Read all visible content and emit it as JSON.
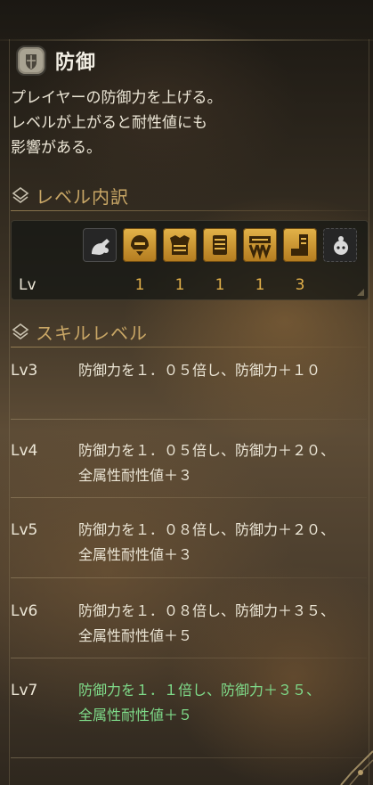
{
  "skill": {
    "name": "防御",
    "icon": "shield-icon",
    "description": [
      "プレイヤーの防御力を上げる。",
      "レベルが上がると耐性値にも",
      "影響がある。"
    ]
  },
  "breakdown": {
    "heading": "レベル内訳",
    "row_label": "Lv",
    "slots": [
      {
        "icon": "weapon-charm-icon",
        "value": ""
      },
      {
        "icon": "helmet-icon",
        "value": "1"
      },
      {
        "icon": "chest-armor-icon",
        "value": "1"
      },
      {
        "icon": "gauntlet-icon",
        "value": "1"
      },
      {
        "icon": "waist-armor-icon",
        "value": "1"
      },
      {
        "icon": "leg-armor-icon",
        "value": "3"
      },
      {
        "icon": "decoration-icon",
        "value": ""
      }
    ]
  },
  "skill_levels": {
    "heading": "スキルレベル",
    "levels": [
      {
        "name": "Lv3",
        "lines": [
          "防御力を１．０５倍し、防御力＋１０"
        ],
        "current": false
      },
      {
        "name": "Lv4",
        "lines": [
          "防御力を１．０５倍し、防御力＋２０、",
          "全属性耐性値＋３"
        ],
        "current": false
      },
      {
        "name": "Lv5",
        "lines": [
          "防御力を１．０８倍し、防御力＋２０、",
          "全属性耐性値＋３"
        ],
        "current": false
      },
      {
        "name": "Lv6",
        "lines": [
          "防御力を１．０８倍し、防御力＋３５、",
          "全属性耐性値＋５"
        ],
        "current": false
      },
      {
        "name": "Lv7",
        "lines": [
          "防御力を１．１倍し、防御力＋３５、",
          "全属性耐性値＋５"
        ],
        "current": true
      }
    ]
  },
  "colors": {
    "accent_gold": "#c9a766",
    "level_value": "#e2b04a",
    "current_level": "#7fdc8a"
  }
}
